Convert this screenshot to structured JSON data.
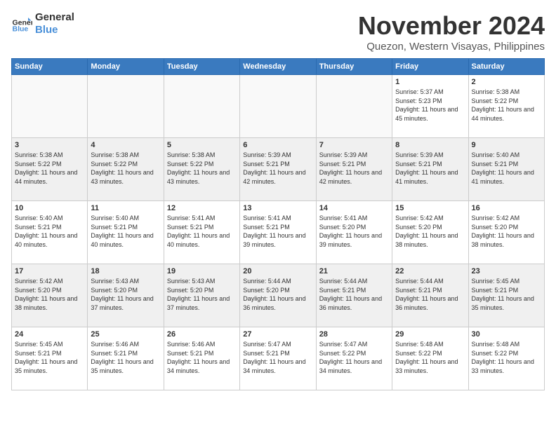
{
  "header": {
    "logo_line1": "General",
    "logo_line2": "Blue",
    "month": "November 2024",
    "location": "Quezon, Western Visayas, Philippines"
  },
  "weekdays": [
    "Sunday",
    "Monday",
    "Tuesday",
    "Wednesday",
    "Thursday",
    "Friday",
    "Saturday"
  ],
  "weeks": [
    [
      {
        "day": "",
        "info": "",
        "empty": true
      },
      {
        "day": "",
        "info": "",
        "empty": true
      },
      {
        "day": "",
        "info": "",
        "empty": true
      },
      {
        "day": "",
        "info": "",
        "empty": true
      },
      {
        "day": "",
        "info": "",
        "empty": true
      },
      {
        "day": "1",
        "info": "Sunrise: 5:37 AM\nSunset: 5:23 PM\nDaylight: 11 hours and 45 minutes."
      },
      {
        "day": "2",
        "info": "Sunrise: 5:38 AM\nSunset: 5:22 PM\nDaylight: 11 hours and 44 minutes."
      }
    ],
    [
      {
        "day": "3",
        "info": "Sunrise: 5:38 AM\nSunset: 5:22 PM\nDaylight: 11 hours and 44 minutes.",
        "shaded": true
      },
      {
        "day": "4",
        "info": "Sunrise: 5:38 AM\nSunset: 5:22 PM\nDaylight: 11 hours and 43 minutes.",
        "shaded": true
      },
      {
        "day": "5",
        "info": "Sunrise: 5:38 AM\nSunset: 5:22 PM\nDaylight: 11 hours and 43 minutes.",
        "shaded": true
      },
      {
        "day": "6",
        "info": "Sunrise: 5:39 AM\nSunset: 5:21 PM\nDaylight: 11 hours and 42 minutes.",
        "shaded": true
      },
      {
        "day": "7",
        "info": "Sunrise: 5:39 AM\nSunset: 5:21 PM\nDaylight: 11 hours and 42 minutes.",
        "shaded": true
      },
      {
        "day": "8",
        "info": "Sunrise: 5:39 AM\nSunset: 5:21 PM\nDaylight: 11 hours and 41 minutes.",
        "shaded": true
      },
      {
        "day": "9",
        "info": "Sunrise: 5:40 AM\nSunset: 5:21 PM\nDaylight: 11 hours and 41 minutes.",
        "shaded": true
      }
    ],
    [
      {
        "day": "10",
        "info": "Sunrise: 5:40 AM\nSunset: 5:21 PM\nDaylight: 11 hours and 40 minutes."
      },
      {
        "day": "11",
        "info": "Sunrise: 5:40 AM\nSunset: 5:21 PM\nDaylight: 11 hours and 40 minutes."
      },
      {
        "day": "12",
        "info": "Sunrise: 5:41 AM\nSunset: 5:21 PM\nDaylight: 11 hours and 40 minutes."
      },
      {
        "day": "13",
        "info": "Sunrise: 5:41 AM\nSunset: 5:21 PM\nDaylight: 11 hours and 39 minutes."
      },
      {
        "day": "14",
        "info": "Sunrise: 5:41 AM\nSunset: 5:20 PM\nDaylight: 11 hours and 39 minutes."
      },
      {
        "day": "15",
        "info": "Sunrise: 5:42 AM\nSunset: 5:20 PM\nDaylight: 11 hours and 38 minutes."
      },
      {
        "day": "16",
        "info": "Sunrise: 5:42 AM\nSunset: 5:20 PM\nDaylight: 11 hours and 38 minutes."
      }
    ],
    [
      {
        "day": "17",
        "info": "Sunrise: 5:42 AM\nSunset: 5:20 PM\nDaylight: 11 hours and 38 minutes.",
        "shaded": true
      },
      {
        "day": "18",
        "info": "Sunrise: 5:43 AM\nSunset: 5:20 PM\nDaylight: 11 hours and 37 minutes.",
        "shaded": true
      },
      {
        "day": "19",
        "info": "Sunrise: 5:43 AM\nSunset: 5:20 PM\nDaylight: 11 hours and 37 minutes.",
        "shaded": true
      },
      {
        "day": "20",
        "info": "Sunrise: 5:44 AM\nSunset: 5:20 PM\nDaylight: 11 hours and 36 minutes.",
        "shaded": true
      },
      {
        "day": "21",
        "info": "Sunrise: 5:44 AM\nSunset: 5:21 PM\nDaylight: 11 hours and 36 minutes.",
        "shaded": true
      },
      {
        "day": "22",
        "info": "Sunrise: 5:44 AM\nSunset: 5:21 PM\nDaylight: 11 hours and 36 minutes.",
        "shaded": true
      },
      {
        "day": "23",
        "info": "Sunrise: 5:45 AM\nSunset: 5:21 PM\nDaylight: 11 hours and 35 minutes.",
        "shaded": true
      }
    ],
    [
      {
        "day": "24",
        "info": "Sunrise: 5:45 AM\nSunset: 5:21 PM\nDaylight: 11 hours and 35 minutes."
      },
      {
        "day": "25",
        "info": "Sunrise: 5:46 AM\nSunset: 5:21 PM\nDaylight: 11 hours and 35 minutes."
      },
      {
        "day": "26",
        "info": "Sunrise: 5:46 AM\nSunset: 5:21 PM\nDaylight: 11 hours and 34 minutes."
      },
      {
        "day": "27",
        "info": "Sunrise: 5:47 AM\nSunset: 5:21 PM\nDaylight: 11 hours and 34 minutes."
      },
      {
        "day": "28",
        "info": "Sunrise: 5:47 AM\nSunset: 5:22 PM\nDaylight: 11 hours and 34 minutes."
      },
      {
        "day": "29",
        "info": "Sunrise: 5:48 AM\nSunset: 5:22 PM\nDaylight: 11 hours and 33 minutes."
      },
      {
        "day": "30",
        "info": "Sunrise: 5:48 AM\nSunset: 5:22 PM\nDaylight: 11 hours and 33 minutes."
      }
    ]
  ]
}
